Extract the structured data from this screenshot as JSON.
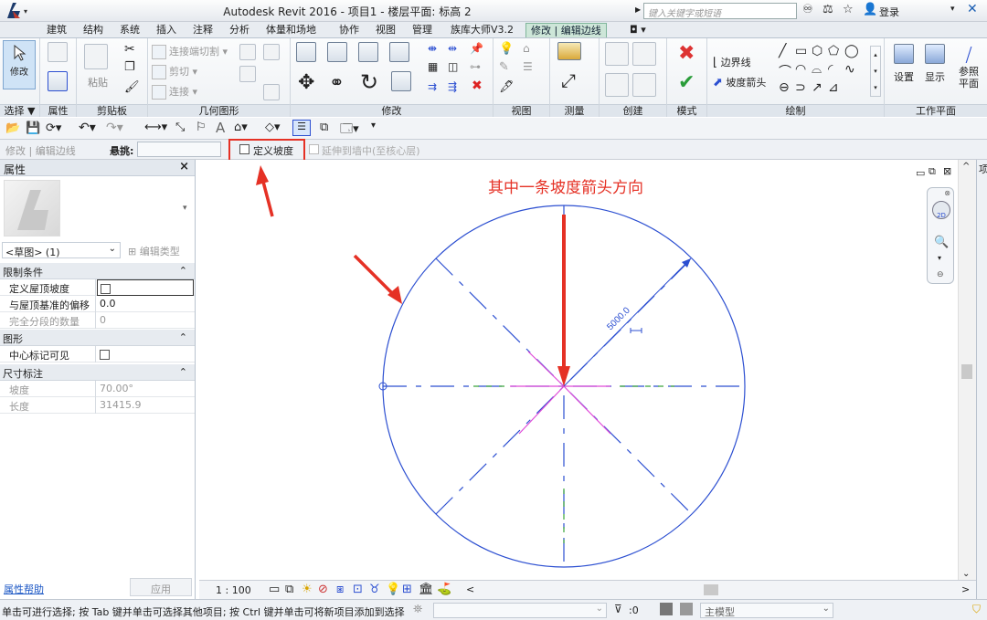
{
  "app": {
    "title": "Autodesk Revit 2016 -     项目1 - 楼层平面: 标高 2"
  },
  "titlebar": {
    "search_placeholder": "键入关键字或短语",
    "login": "登录"
  },
  "tabs": [
    "建筑",
    "结构",
    "系统",
    "插入",
    "注释",
    "分析",
    "体量和场地",
    "协作",
    "视图",
    "管理",
    "族库大师V3.2",
    "修改 | 编辑边线"
  ],
  "ribbon": {
    "panels": {
      "select": "选择 ▼",
      "properties": "属性",
      "clipboard": "剪贴板",
      "geometry": "几何图形",
      "modify": "修改",
      "view": "视图",
      "measure": "测量",
      "create": "创建",
      "mode": "模式",
      "draw": "绘制",
      "work_plane": "工作平面"
    },
    "modify_button": "修改",
    "paste": "粘贴",
    "geometry_items": [
      "连接端切割 ▾",
      "剪切 ▾",
      "连接 ▾"
    ],
    "boundary_line": "边界线",
    "slope_arrow": "坡度箭头",
    "wp_buttons": [
      "设置",
      "显示",
      "参照平面"
    ]
  },
  "options_bar": {
    "breadcrumb": "修改 | 编辑边线",
    "overhang_label": "悬挑:",
    "define_slope": "定义坡度",
    "extend_to_wall": "延伸到墙中(至核心层)"
  },
  "properties": {
    "header": "属性",
    "close": "×",
    "type_selector": "<草图> (1)",
    "edit_type": "编辑类型",
    "categories": [
      {
        "name": "限制条件",
        "rows": [
          {
            "name": "定义屋顶坡度",
            "value": "",
            "checkbox": true
          },
          {
            "name": "与屋顶基准的偏移",
            "value": "0.0"
          },
          {
            "name": "完全分段的数量",
            "value": "0",
            "greyed": true
          }
        ]
      },
      {
        "name": "图形",
        "rows": [
          {
            "name": "中心标记可见",
            "value": "",
            "checkbox": true
          }
        ]
      },
      {
        "name": "尺寸标注",
        "rows": [
          {
            "name": "坡度",
            "value": "70.00°",
            "greyed": true
          },
          {
            "name": "长度",
            "value": "31415.9",
            "greyed": true
          }
        ]
      }
    ],
    "help_link": "属性帮助",
    "apply": "应用"
  },
  "canvas": {
    "annotation": "其中一条坡度箭头方向",
    "dimension": "5000.0"
  },
  "view_bar": {
    "scale": "1 : 100"
  },
  "status": {
    "message": "单击可进行选择; 按 Tab 键并单击可选择其他项目; 按 Ctrl 键并单击可将新项目添加到选择",
    "selection_count": ":0",
    "model": "主模型"
  },
  "colors": {
    "accent_red": "#e53125",
    "circle_blue": "#2c4fd1",
    "ribbon_tab_active": "#cde6d8"
  }
}
